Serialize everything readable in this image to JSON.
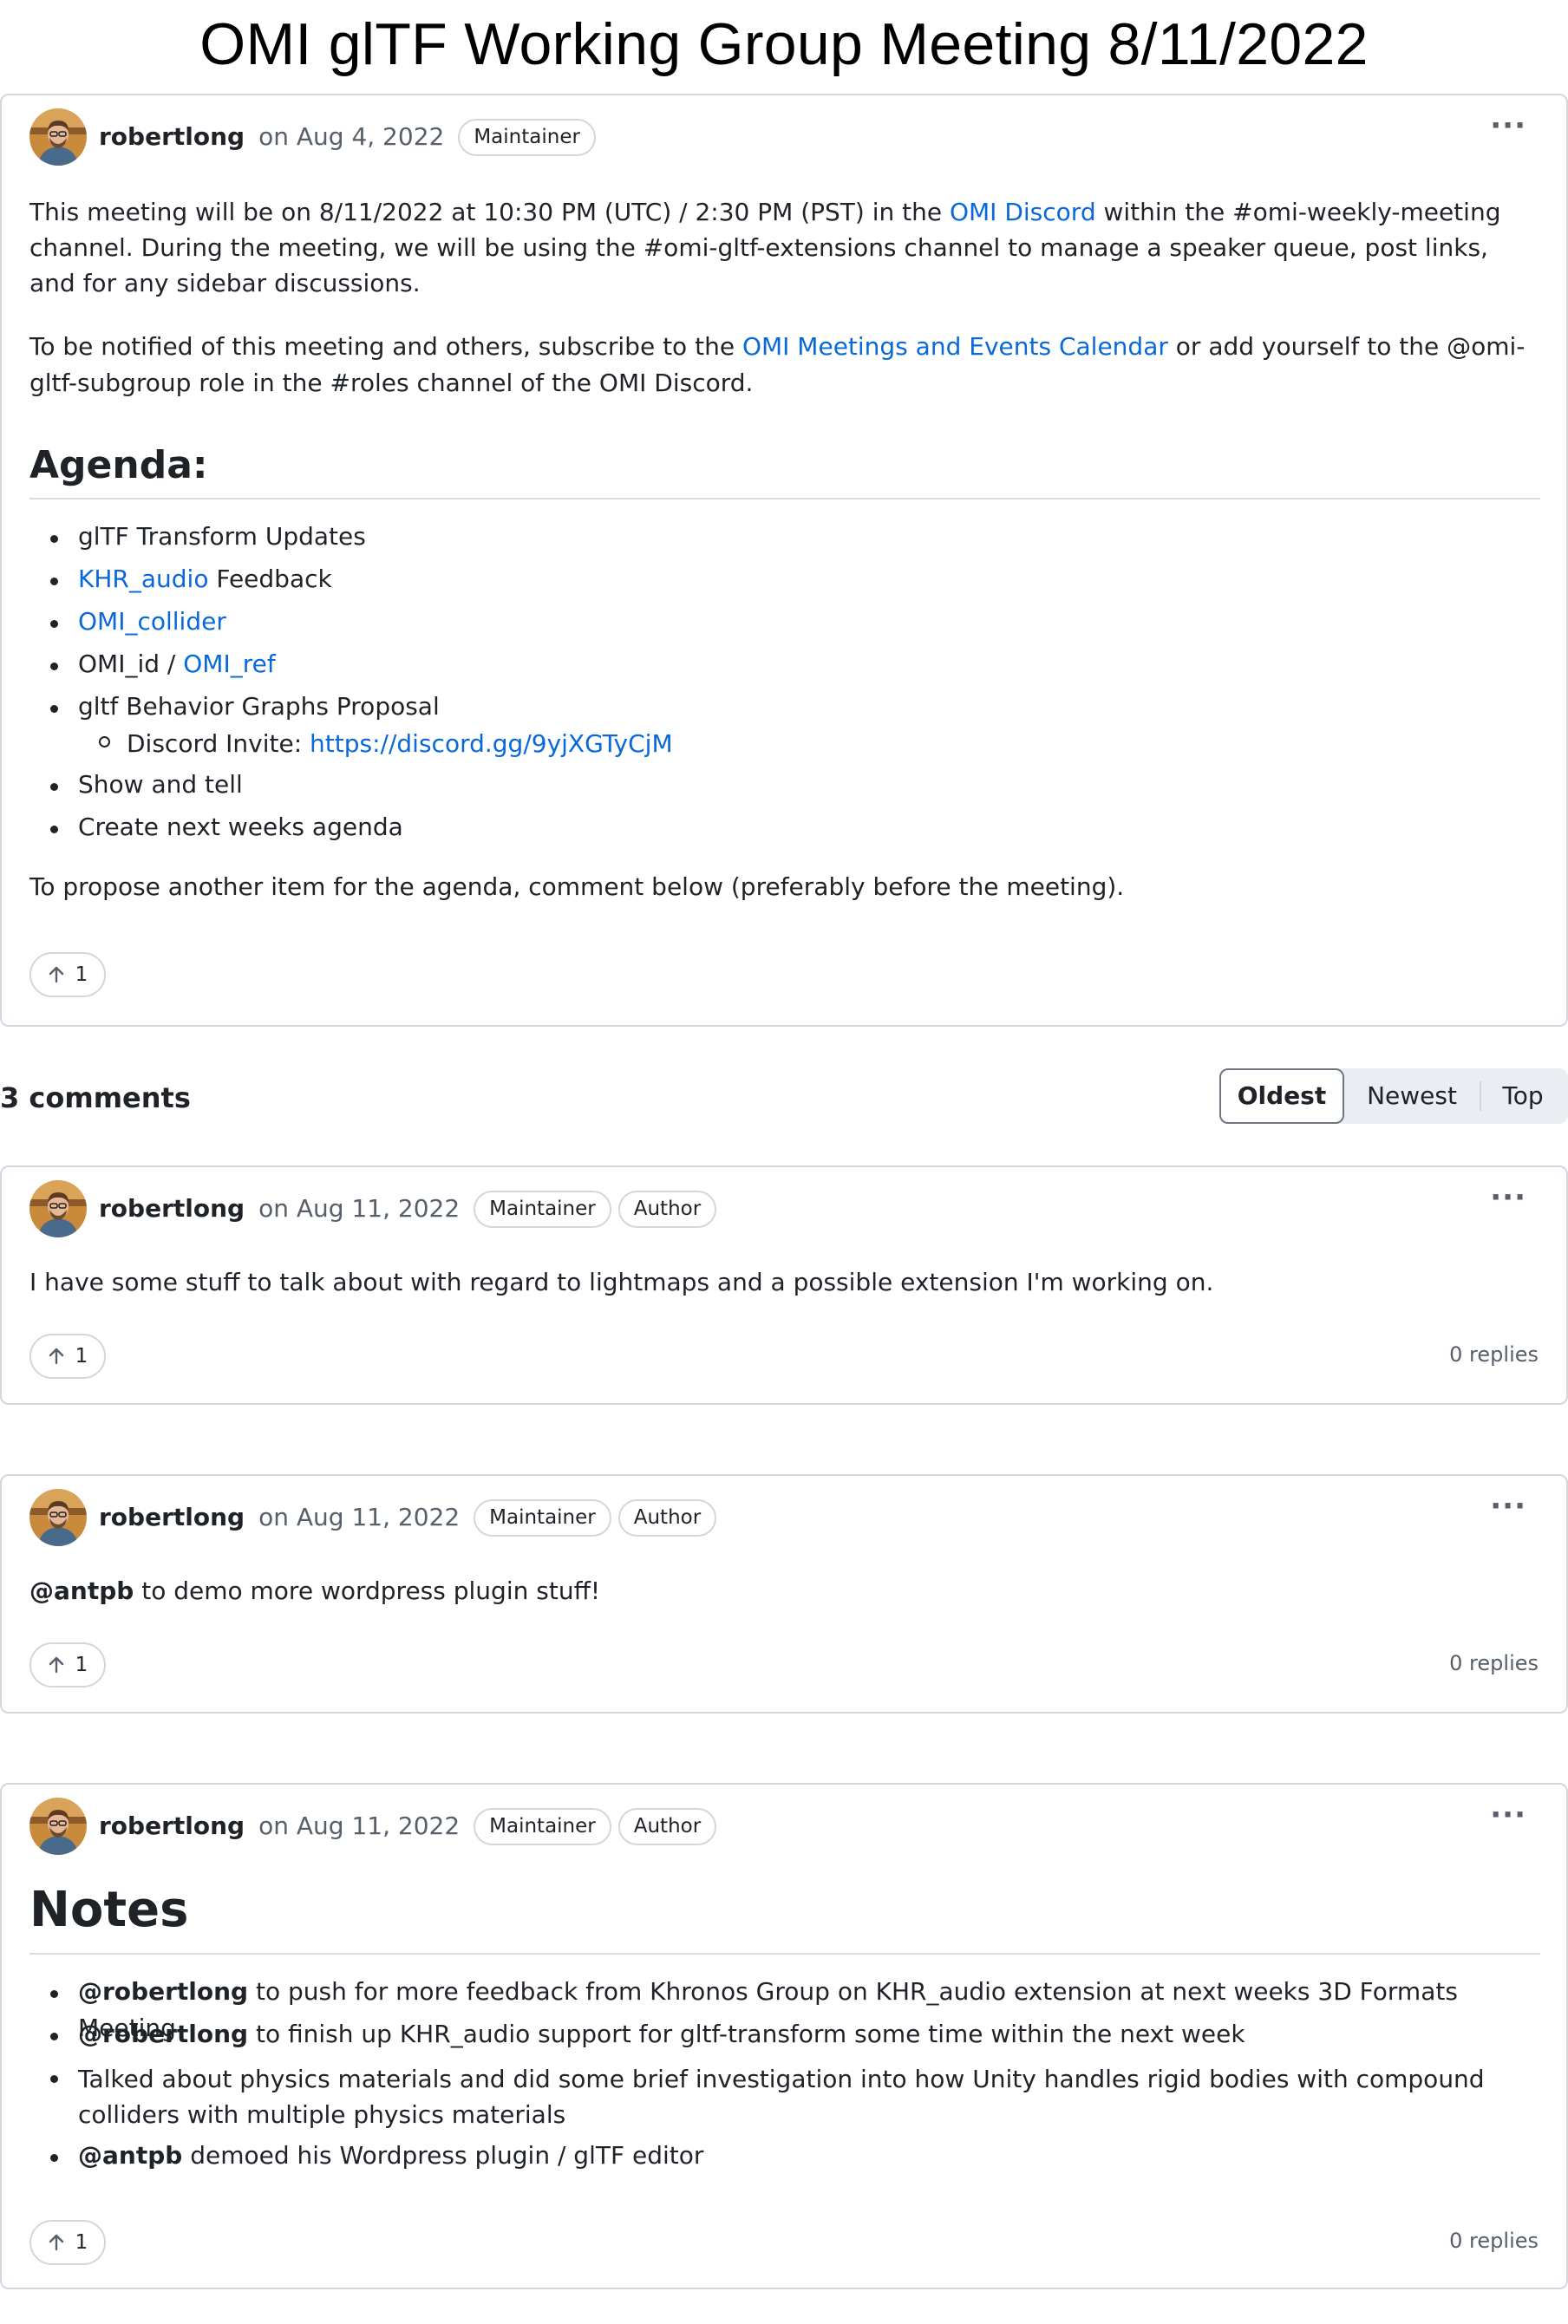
{
  "page": {
    "title": "OMI glTF Working Group Meeting 8/11/2022"
  },
  "post": {
    "author": "robertlong",
    "date": "on Aug 4, 2022",
    "badge": "Maintainer",
    "menu": "···",
    "para1": {
      "t1": "This meeting will be on 8/11/2022 at 10:30 PM (UTC) / 2:30 PM (PST) in the ",
      "link": "OMI Discord",
      "t2": " within the #omi-weekly-meeting channel. During the meeting, we will be using the #omi-gltf-extensions channel to manage a speaker queue, post links, and for any sidebar discussions."
    },
    "para2": {
      "t1": "To be notified of this meeting and others, subscribe to the ",
      "link": "OMI Meetings and Events Calendar",
      "t2": " or add yourself to the @omi-gltf-subgroup role in the #roles channel of the OMI Discord."
    },
    "agenda_heading": "Agenda:",
    "agenda": {
      "item1": "glTF Transform Updates",
      "item2_link": "KHR_audio",
      "item2_text": " Feedback",
      "item3_link": "OMI_collider",
      "item4_text": "OMI_id / ",
      "item4_link": "OMI_ref",
      "item5": "gltf Behavior Graphs Proposal",
      "item5_sub_text": "Discord Invite: ",
      "item5_sub_link": "https://discord.gg/9yjXGTyCjM",
      "item6": "Show and tell",
      "item7": "Create next weeks agenda"
    },
    "closing": "To propose another item for the agenda, comment below (preferably before the meeting).",
    "votes": "1"
  },
  "comments_header": {
    "count": "3 comments",
    "sort_options": [
      "Oldest",
      "Newest",
      "Top"
    ],
    "sort_selected": "Oldest"
  },
  "comments": [
    {
      "author": "robertlong",
      "date": "on Aug 11, 2022",
      "badges": [
        "Maintainer",
        "Author"
      ],
      "text": "I have some stuff to talk about with regard to lightmaps and a possible extension I'm working on.",
      "votes": "1",
      "replies": "0 replies"
    },
    {
      "author": "robertlong",
      "date": "on Aug 11, 2022",
      "badges": [
        "Maintainer",
        "Author"
      ],
      "mention": "@antpb",
      "text": " to demo more wordpress plugin stuff!",
      "votes": "1",
      "replies": "0 replies"
    },
    {
      "author": "robertlong",
      "date": "on Aug 11, 2022",
      "badges": [
        "Maintainer",
        "Author"
      ],
      "heading": "Notes",
      "notes": [
        {
          "mention": "@robertlong",
          "text": " to push for more feedback from Khronos Group on KHR_audio extension at next weeks 3D Formats Meeting"
        },
        {
          "mention": "@robertlong",
          "text": " to finish up KHR_audio support for gltf-transform some time within the next week"
        },
        {
          "mention": "",
          "text": "Talked about physics materials and did some brief investigation into how Unity handles rigid bodies with compound colliders with multiple physics materials"
        },
        {
          "mention": "@antpb",
          "text": " demoed his Wordpress plugin / glTF editor"
        }
      ],
      "votes": "1",
      "replies": "0 replies"
    }
  ],
  "icons": {
    "avatar": "avatar-photo",
    "menu": "kebab-horizontal-icon",
    "upvote": "arrow-up-icon"
  }
}
